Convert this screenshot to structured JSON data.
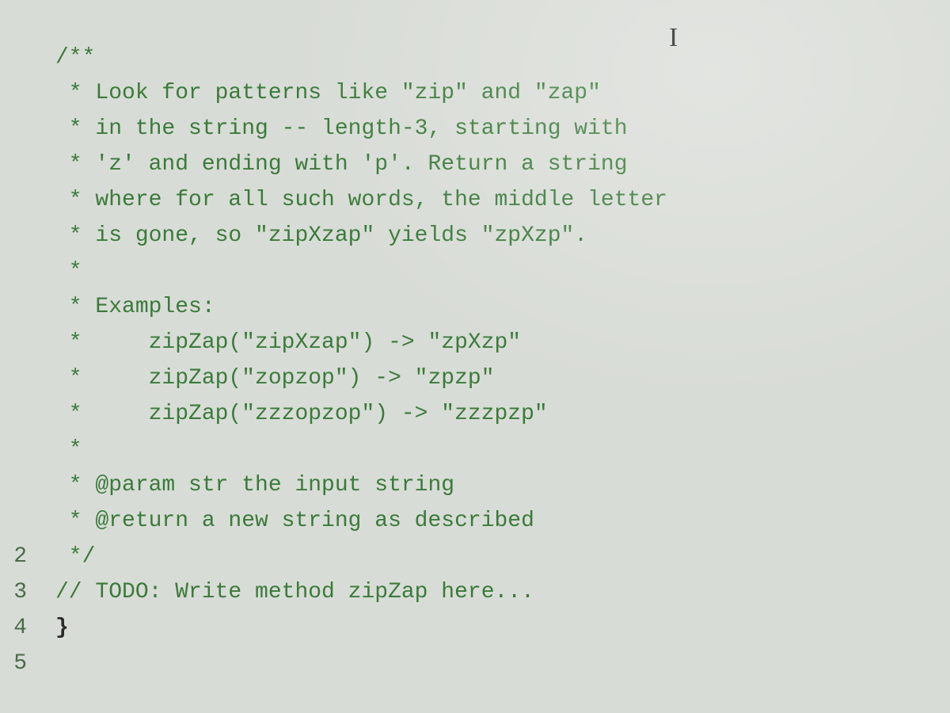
{
  "cursor_glyph": "I",
  "gutter": {
    "visible_lines": [
      "",
      "",
      "",
      "",
      "",
      "",
      "",
      "",
      "",
      "",
      "",
      "",
      "",
      "",
      "2",
      "3",
      "4",
      "5"
    ]
  },
  "code": {
    "lines": [
      {
        "text": "/**",
        "cls": "comment"
      },
      {
        "text": " * Look for patterns like \"zip\" and \"zap\"",
        "cls": "comment"
      },
      {
        "text": " * in the string -- length-3, starting with",
        "cls": "comment"
      },
      {
        "text": " * 'z' and ending with 'p'. Return a string",
        "cls": "comment"
      },
      {
        "text": " * where for all such words, the middle letter",
        "cls": "comment"
      },
      {
        "text": " * is gone, so \"zipXzap\" yields \"zpXzp\".",
        "cls": "comment"
      },
      {
        "text": " *",
        "cls": "comment"
      },
      {
        "text": " * Examples:",
        "cls": "comment"
      },
      {
        "text": " *     zipZap(\"zipXzap\") -> \"zpXzp\"",
        "cls": "comment"
      },
      {
        "text": " *     zipZap(\"zopzop\") -> \"zpzp\"",
        "cls": "comment"
      },
      {
        "text": " *     zipZap(\"zzzopzop\") -> \"zzzpzp\"",
        "cls": "comment"
      },
      {
        "text": " *",
        "cls": "comment"
      },
      {
        "text": " * @param str the input string",
        "cls": "comment"
      },
      {
        "text": " * @return a new string as described",
        "cls": "comment"
      },
      {
        "text": " */",
        "cls": "comment"
      },
      {
        "text": "// TODO: Write method zipZap here...",
        "cls": "comment"
      },
      {
        "text": "}",
        "cls": "brace"
      }
    ]
  }
}
